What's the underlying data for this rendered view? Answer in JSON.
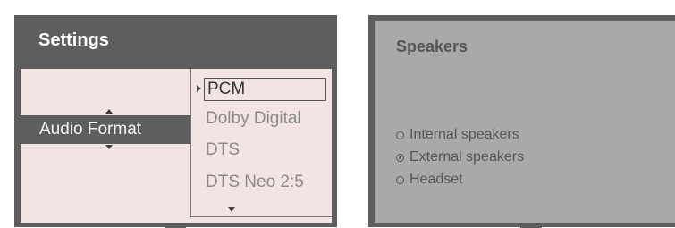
{
  "settings_screen": {
    "title": "Settings",
    "setting_label": "Audio Format",
    "format_options": [
      "PCM",
      "Dolby Digital",
      "DTS",
      "DTS Neo 2:5"
    ],
    "selected_format": "PCM"
  },
  "speakers_screen": {
    "title": "Speakers",
    "options": [
      {
        "label": "Internal speakers",
        "checked": false
      },
      {
        "label": "External speakers",
        "checked": true
      },
      {
        "label": "Headset",
        "checked": false
      }
    ]
  },
  "colors": {
    "bezel": "#5e5e5e",
    "settings_background": "#f3e4e4",
    "speakers_background": "#a9a9a9"
  }
}
